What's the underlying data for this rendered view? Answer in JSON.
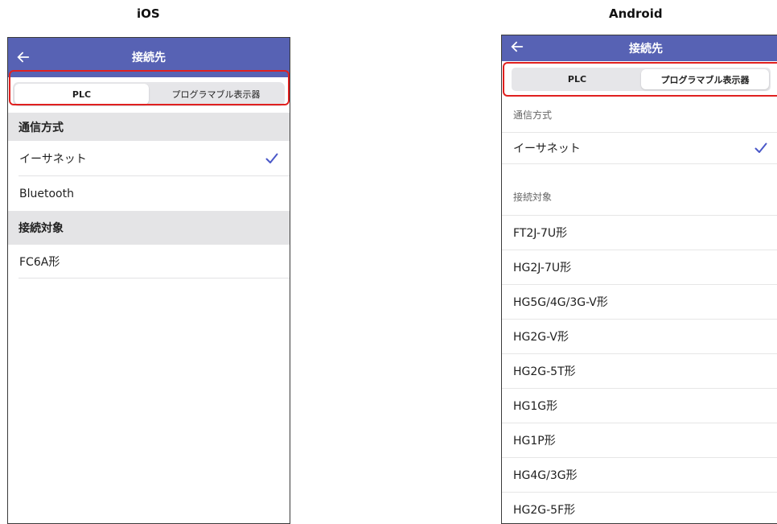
{
  "ios": {
    "platform_label": "iOS",
    "title": "接続先",
    "segments": [
      "PLC",
      "プログラマブル表示器"
    ],
    "selected_segment": "PLC",
    "comm_header": "通信方式",
    "comm_items": [
      {
        "label": "イーサネット",
        "checked": true
      },
      {
        "label": "Bluetooth",
        "checked": false
      }
    ],
    "target_header": "接続対象",
    "target_items": [
      "FC6A形"
    ]
  },
  "android": {
    "platform_label": "Android",
    "title": "接続先",
    "segments": [
      "PLC",
      "プログラマブル表示器"
    ],
    "selected_segment": "プログラマブル表示器",
    "comm_header": "通信方式",
    "comm_items": [
      {
        "label": "イーサネット",
        "checked": true
      }
    ],
    "target_header": "接続対象",
    "target_items": [
      "FT2J-7U形",
      "HG2J-7U形",
      "HG5G/4G/3G-V形",
      "HG2G-V形",
      "HG2G-5T形",
      "HG1G形",
      "HG1P形",
      "HG4G/3G形",
      "HG2G-5F形"
    ]
  },
  "colors": {
    "appbar": "#5762b4",
    "checkmark": "#4a58c8",
    "highlight": "#e0201f",
    "section_bg": "#e4e4e6"
  },
  "icons": {
    "back": "arrow-left-icon",
    "check": "checkmark-icon"
  }
}
